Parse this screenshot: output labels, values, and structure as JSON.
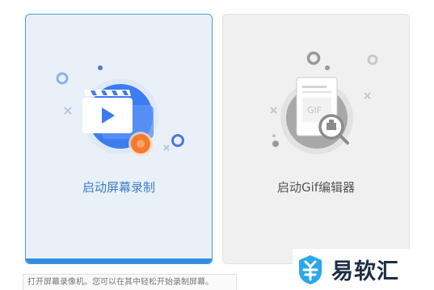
{
  "cards": [
    {
      "label": "启动屏幕录制",
      "icon": "screen-record-icon",
      "selected": true
    },
    {
      "label": "启动Gif编辑器",
      "icon": "gif-editor-icon",
      "selected": false
    }
  ],
  "gif_doc_text": "GIF",
  "hint": "打开屏幕录像机。您可以在其中轻松开始录制屏幕。",
  "brand": {
    "name": "易软汇",
    "logo": "brand-logo-icon"
  },
  "colors": {
    "accent": "#2f8fe0",
    "selected_bg": "#eaf0f8",
    "disabled_bg": "#f0f0f0",
    "brand_text": "#1d2d44",
    "brand_icon": "#2ca7e8"
  }
}
